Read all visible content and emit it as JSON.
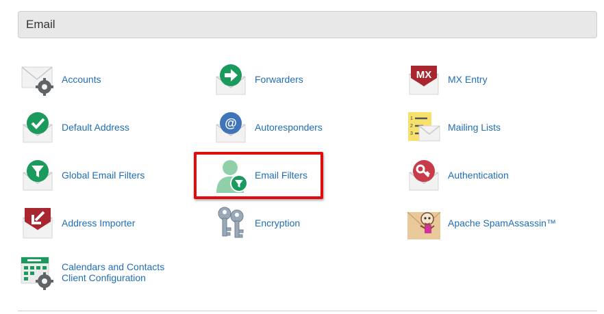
{
  "section": {
    "title": "Email"
  },
  "items": {
    "accounts": {
      "label": "Accounts",
      "icon": "envelope-gear-icon"
    },
    "forwarders": {
      "label": "Forwarders",
      "icon": "envelope-forward-arrow-icon"
    },
    "mx_entry": {
      "label": "MX Entry",
      "icon": "envelope-mx-icon"
    },
    "default_address": {
      "label": "Default Address",
      "icon": "envelope-checkmark-icon"
    },
    "autoresponders": {
      "label": "Autoresponders",
      "icon": "envelope-at-icon"
    },
    "mailing_lists": {
      "label": "Mailing Lists",
      "icon": "list-envelope-icon"
    },
    "global_email_filters": {
      "label": "Global Email Filters",
      "icon": "envelope-filter-icon"
    },
    "email_filters": {
      "label": "Email Filters",
      "icon": "user-filter-icon"
    },
    "authentication": {
      "label": "Authentication",
      "icon": "envelope-key-icon"
    },
    "address_importer": {
      "label": "Address Importer",
      "icon": "envelope-import-arrow-icon"
    },
    "encryption": {
      "label": "Encryption",
      "icon": "keys-icon"
    },
    "apache_spamassassin": {
      "label": "Apache SpamAssassin™",
      "icon": "spamassassin-icon"
    },
    "calendars_contacts": {
      "label_line1": "Calendars and Contacts",
      "label_line2": "Client Configuration",
      "icon": "calendar-gear-icon"
    }
  },
  "highlight": {
    "target": "Email Filters",
    "color": "#e10d0d"
  },
  "colors": {
    "link": "#1f6db6",
    "header_bg": "#e8e8e8",
    "green": "#1a9a5c",
    "red": "#b8323f",
    "blue": "#3f74b8"
  }
}
